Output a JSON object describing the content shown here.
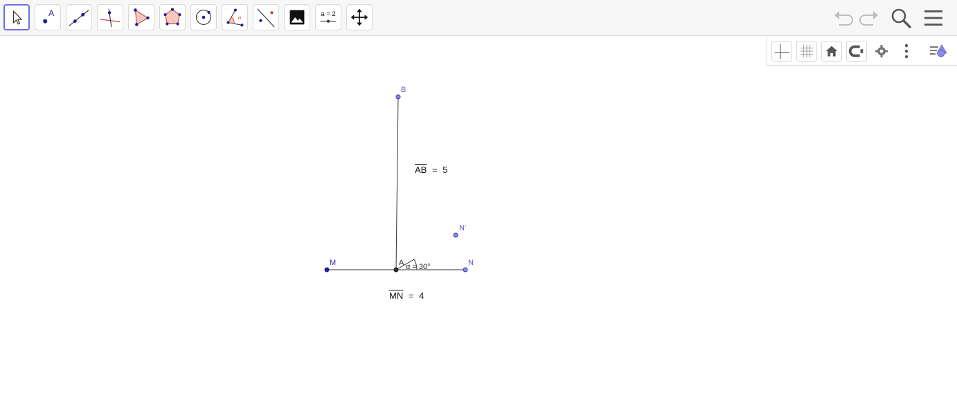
{
  "toolbar": {
    "tools": [
      {
        "icon": "move-cursor-icon"
      },
      {
        "icon": "point-icon",
        "glyph": "A"
      },
      {
        "icon": "line-icon"
      },
      {
        "icon": "perpendicular-line-icon"
      },
      {
        "icon": "polygon-icon"
      },
      {
        "icon": "regular-polygon-icon"
      },
      {
        "icon": "circle-center-point-icon"
      },
      {
        "icon": "angle-icon",
        "glyph": "α"
      },
      {
        "icon": "reflect-line-icon"
      },
      {
        "icon": "image-icon"
      },
      {
        "icon": "slider-icon",
        "glyph": "a = 2"
      },
      {
        "icon": "move-graphics-view-icon"
      }
    ],
    "right": [
      "undo-icon",
      "redo-icon",
      "search-icon",
      "menu-icon"
    ]
  },
  "stylebar": {
    "buttons": [
      "axes-toggle-icon",
      "grid-toggle-icon",
      "home-icon",
      "point-capture-icon",
      "settings-gear-icon",
      "more-options-icon",
      "style-bar-toggle-icon"
    ]
  },
  "construction": {
    "points": {
      "B": "B",
      "A": "A",
      "M": "M",
      "N": "N",
      "N_prime": "N'"
    },
    "angle": {
      "name": "α",
      "label": "α = 30°"
    },
    "measurements": {
      "ab": {
        "segment": "AB",
        "equals": "=",
        "value": "5"
      },
      "mn": {
        "segment": "MN",
        "equals": "=",
        "value": "4"
      }
    }
  },
  "colors": {
    "accent": "#6e6ee6",
    "point_fill": "#5a5ad6",
    "point_dark": "#1e1e9a",
    "segment": "#333333"
  }
}
